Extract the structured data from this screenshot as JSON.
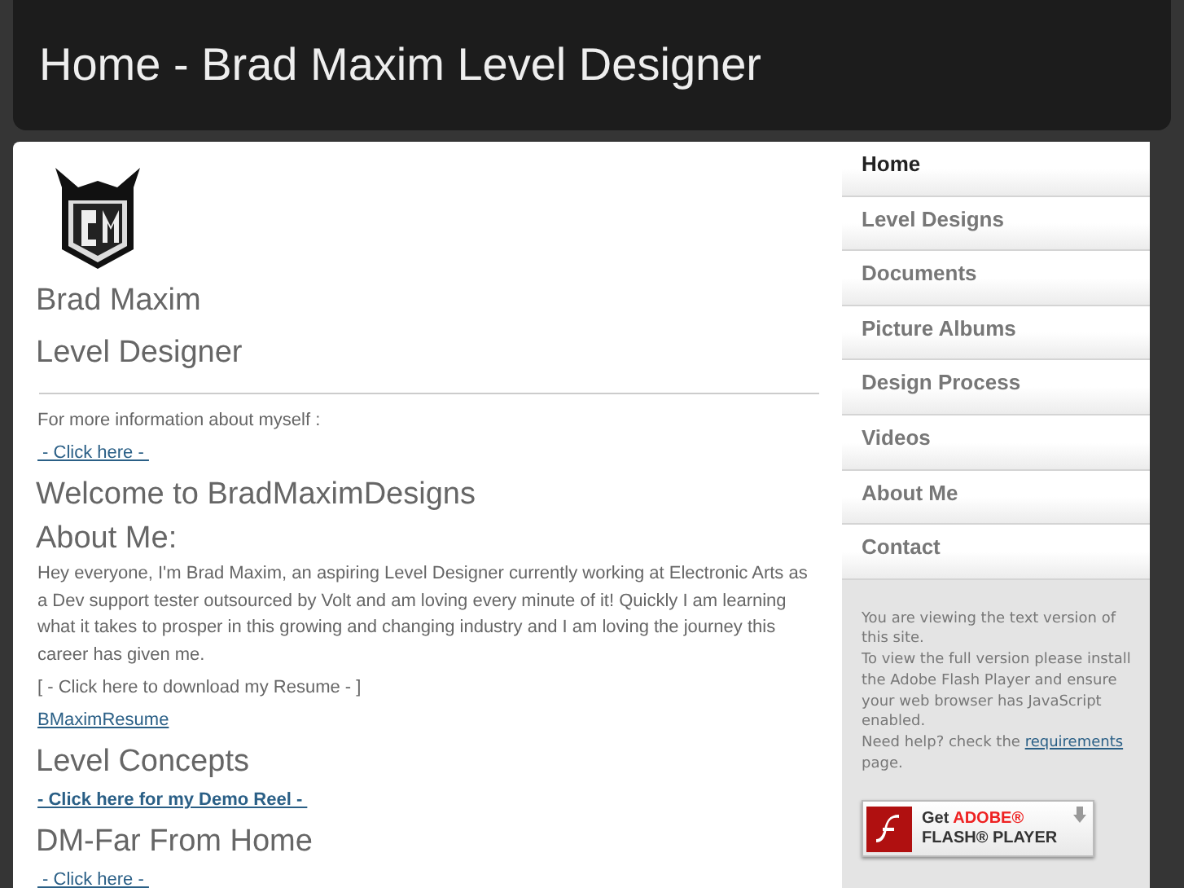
{
  "header": {
    "title": "Home - Brad Maxim Level Designer"
  },
  "intro": {
    "name": "Brad Maxim",
    "role": "Level Designer"
  },
  "content": [
    {
      "kind": "text",
      "text": "For more information about myself :"
    },
    {
      "kind": "link",
      "text": " - Click here - "
    },
    {
      "kind": "heading",
      "text": "Welcome to BradMaximDesigns"
    },
    {
      "kind": "heading",
      "text": "About Me:"
    },
    {
      "kind": "paragraph",
      "text": "Hey everyone, I'm Brad Maxim, an aspiring Level Designer currently working at Electronic Arts as a Dev support tester outsourced by Volt and am loving every minute of it! Quickly I am learning what it takes to prosper in this growing and changing industry and I am loving the journey this career has given me."
    },
    {
      "kind": "text",
      "text": "[ - Click here to download my Resume - ]"
    },
    {
      "kind": "link",
      "text": "BMaximResume"
    },
    {
      "kind": "heading",
      "text": "Level Concepts"
    },
    {
      "kind": "boldlink",
      "text": "- Click here for my Demo Reel - "
    },
    {
      "kind": "heading",
      "text": "DM-Far From Home"
    },
    {
      "kind": "link",
      "text": " - Click here - "
    }
  ],
  "nav": [
    {
      "label": "Home",
      "selected": true
    },
    {
      "label": "Level Designs",
      "selected": false
    },
    {
      "label": "Documents",
      "selected": false
    },
    {
      "label": "Picture Albums",
      "selected": false
    },
    {
      "label": "Design Process",
      "selected": false
    },
    {
      "label": "Videos",
      "selected": false
    },
    {
      "label": "About Me",
      "selected": false
    },
    {
      "label": "Contact",
      "selected": false
    }
  ],
  "notice": {
    "line_1": "You are viewing the text version of this site.",
    "line_2": "To view the full version please install the Adobe Flash Player and ensure your web browser has JavaScript enabled.",
    "help_before": "Need help? check the ",
    "help_link": "requirements",
    "help_after": " page."
  },
  "flash_badge": {
    "get": "Get",
    "brand": "ADOBE®",
    "product": "FLASH® PLAYER"
  }
}
